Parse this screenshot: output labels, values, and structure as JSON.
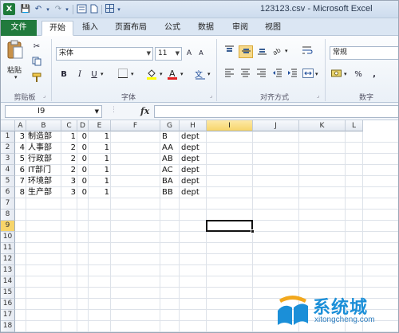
{
  "window": {
    "title": "123123.csv - Microsoft Excel"
  },
  "qat": {
    "save": "💾",
    "undo": "↶",
    "redo": "↷",
    "more": "▾"
  },
  "tabs": [
    {
      "label": "文件"
    },
    {
      "label": "开始"
    },
    {
      "label": "插入"
    },
    {
      "label": "页面布局"
    },
    {
      "label": "公式"
    },
    {
      "label": "数据"
    },
    {
      "label": "审阅"
    },
    {
      "label": "视图"
    }
  ],
  "ribbon": {
    "clipboard": {
      "paste": "粘贴",
      "label": "剪贴板"
    },
    "font": {
      "name": "宋体",
      "size": "11",
      "bold": "B",
      "italic": "I",
      "underline": "U",
      "label": "字体"
    },
    "alignment": {
      "label": "对齐方式"
    },
    "number": {
      "format": "常规",
      "percent": "%",
      "comma": ",",
      "label": "数字"
    }
  },
  "formula_bar": {
    "name_box": "I9",
    "fx": "fx",
    "value": ""
  },
  "sheet": {
    "columns": [
      "A",
      "B",
      "C",
      "D",
      "E",
      "F",
      "G",
      "H",
      "I",
      "J",
      "K",
      "L"
    ],
    "active_column": "I",
    "active_row": "9",
    "rows": [
      "1",
      "2",
      "3",
      "4",
      "5",
      "6",
      "7",
      "8",
      "9",
      "10",
      "11",
      "12",
      "13",
      "14",
      "15",
      "16",
      "17",
      "18"
    ],
    "data": [
      [
        "3",
        "制造部",
        "1",
        "0",
        "1",
        "",
        "B",
        "dept"
      ],
      [
        "4",
        "人事部",
        "2",
        "0",
        "1",
        "",
        "AA",
        "dept"
      ],
      [
        "5",
        "行政部",
        "2",
        "0",
        "1",
        "",
        "AB",
        "dept"
      ],
      [
        "6",
        "IT部门",
        "2",
        "0",
        "1",
        "",
        "AC",
        "dept"
      ],
      [
        "7",
        "环境部",
        "3",
        "0",
        "1",
        "",
        "BA",
        "dept"
      ],
      [
        "8",
        "生产部",
        "3",
        "0",
        "1",
        "",
        "BB",
        "dept"
      ]
    ]
  },
  "watermark": {
    "text": "系统城",
    "url": "xitongcheng.com"
  },
  "colors": {
    "file_tab": "#217a3d",
    "selection_header": "#f7d56a",
    "watermark": "#1b8fd8"
  }
}
